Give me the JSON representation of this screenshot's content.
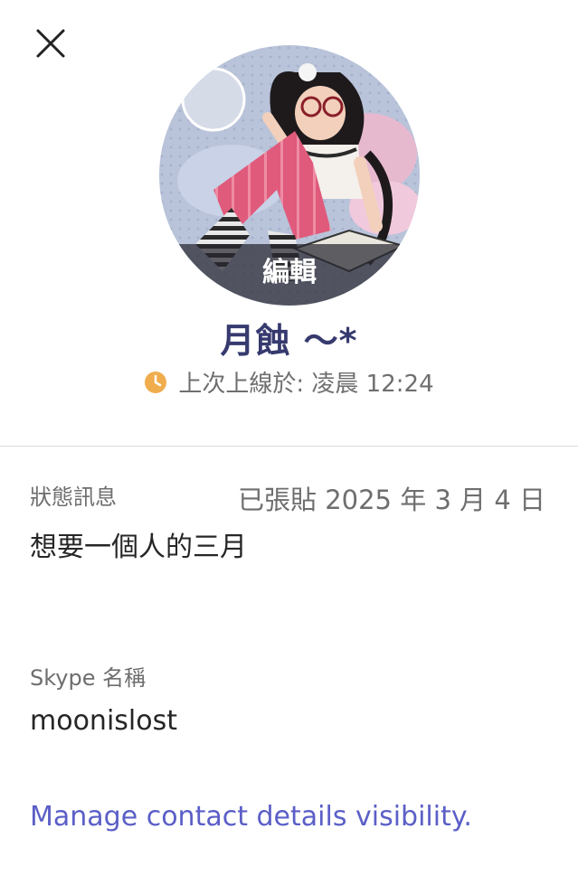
{
  "profile": {
    "edit_label": "編輯",
    "display_name": "月蝕 ～*",
    "last_seen": "上次上線於: 凌晨 12:24"
  },
  "status": {
    "label": "狀態訊息",
    "posted": "已張貼 2025 年 3 月 4 日",
    "message": "想要一個人的三月"
  },
  "skype": {
    "label": "Skype 名稱",
    "value": "moonislost"
  },
  "links": {
    "manage": "Manage contact details visibility."
  },
  "icons": {
    "close": "close-icon",
    "clock": "clock-icon"
  },
  "colors": {
    "name": "#363a6e",
    "link": "#5b5fc7",
    "clock": "#f0ad4e"
  }
}
